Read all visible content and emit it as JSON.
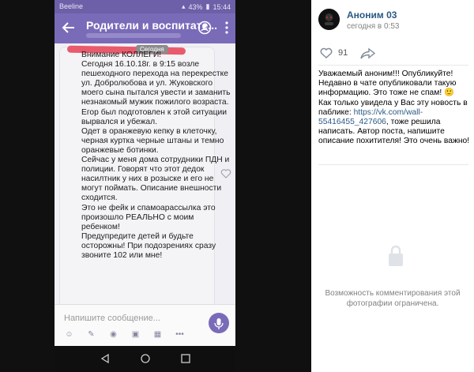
{
  "status": {
    "carrier": "Beeline",
    "battery": "43%",
    "time": "15:44"
  },
  "chat": {
    "title": "Родители и воспитате...",
    "date_chip": "Сегодня",
    "message": "Внимание КОЛЛЕГИ!\nСегодня 16.10.18г. в 9:15 возле пешеходного перехода на перекрестке ул. Добролюбова и ул. Жуковского моего сына пытался увести и заманить незнакомый мужик пожилого возраста. Егор был подготовлен к этой ситуации вырвался и убежал.\nОдет в оранжевую кепку в клеточку, черная куртка черные штаны и темно оранжевые ботинки.\nСейчас у меня дома сотрудники ПДН и полиции. Говорят что этот дедок насилтник у них в розыске и его не могут поймать. Описание внешности сходится.\nЭто не фейк и спамоарассылка это произошло РЕАЛЬНО с моим ребенком!\nПредупредите детей и будьте осторожны! При подозрениях сразу звоните 102 или мне!",
    "input_placeholder": "Напишите сообщение..."
  },
  "post": {
    "author": "Аноним 03",
    "time": "сегодня в 0:53",
    "likes": "91",
    "text_part1": "Уважаемый аноним!!! Опубликуйте! Недавно в чате опубликовали такую информацию. Это тоже не спам! ",
    "text_part2": "Как только увидела у Вас эту новость в паблике: ",
    "link": "https://vk.com/wall-55416455_427606",
    "text_part3": ", тоже решила написать. Автор поста, напишите описание похитителя! Это очень важно!",
    "comments_restricted": "Возможность комментирования этой фотографии ограничена."
  },
  "colors": {
    "accent": "#7a6bb9",
    "link": "#2a5885"
  }
}
